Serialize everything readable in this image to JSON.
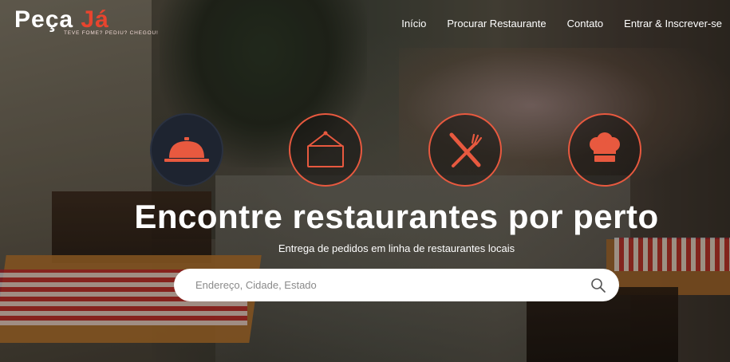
{
  "brand": {
    "name_part1": "Peça ",
    "name_part2": "Já",
    "tagline": "TEVE FOME? PEDIU? CHEGOU!"
  },
  "nav": {
    "items": [
      "Início",
      "Procurar Restaurante",
      "Contato",
      "Entrar & Inscrever-se"
    ]
  },
  "features": {
    "icons": [
      "cloche-icon",
      "signboard-icon",
      "knife-fork-icon",
      "chef-hat-icon"
    ]
  },
  "hero": {
    "title": "Encontre restaurantes por perto",
    "subtitle": "Entrega de pedidos em linha de restaurantes locais"
  },
  "search": {
    "placeholder": "Endereço, Cidade, Estado",
    "value": "",
    "icon": "search-icon"
  },
  "colors": {
    "accent": "#e8593f",
    "active_circle": "#1e2430",
    "text": "#ffffff"
  }
}
